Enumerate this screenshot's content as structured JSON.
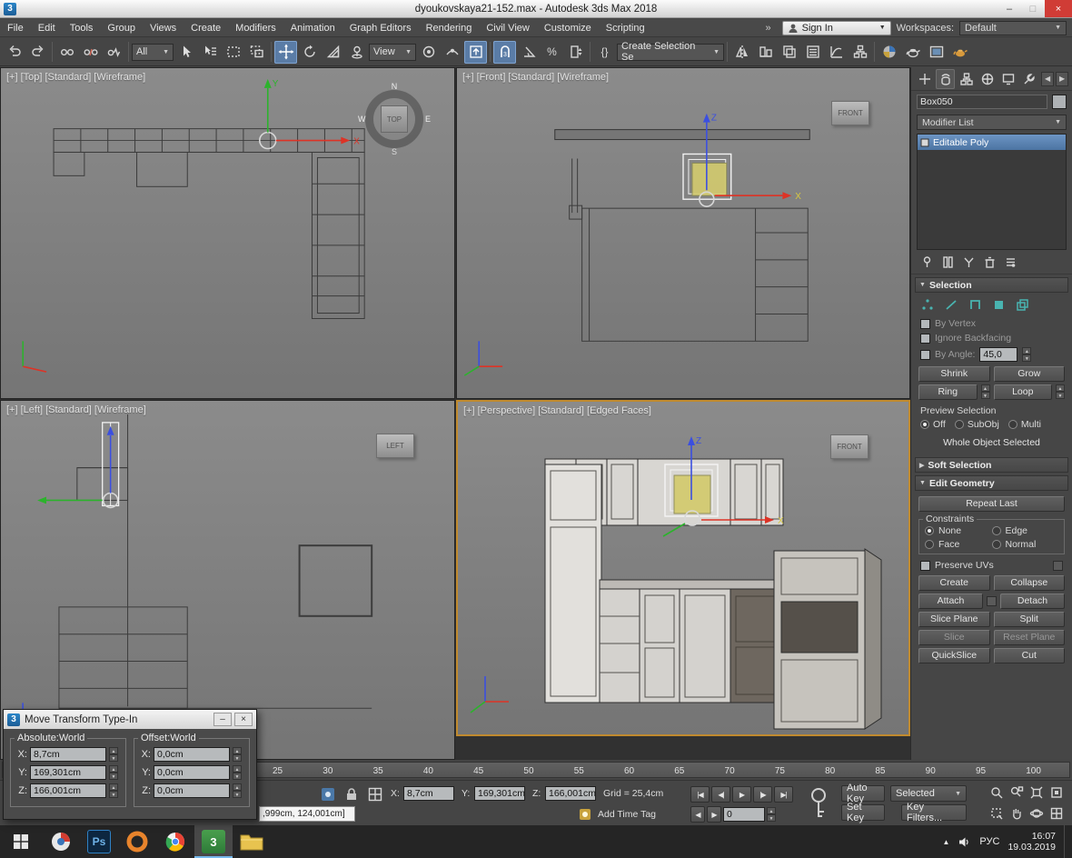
{
  "titlebar": {
    "title": "dyoukovskaya21-152.max - Autodesk 3ds Max 2018",
    "app_glyph": "3"
  },
  "menubar": {
    "items": [
      "File",
      "Edit",
      "Tools",
      "Group",
      "Views",
      "Create",
      "Modifiers",
      "Animation",
      "Graph Editors",
      "Rendering",
      "Civil View",
      "Customize",
      "Scripting"
    ],
    "sign_in": "Sign In",
    "workspaces_label": "Workspaces:",
    "workspace_value": "Default"
  },
  "toolbar": {
    "selection_filter": "All",
    "coord_system": "View",
    "selection_set_field": "Create Selection Se",
    "percent_glyph": "%",
    "braces_glyph": "{}"
  },
  "viewports": {
    "top_label": "[+] [Top] [Standard] [Wireframe]",
    "front_label": "[+] [Front] [Standard] [Wireframe]",
    "left_label": "[+] [Left] [Standard] [Wireframe]",
    "persp_label": "[+] [Perspective] [Standard] [Edged Faces]",
    "viewcube": {
      "n": "N",
      "w": "W",
      "s": "S",
      "e": "E",
      "top": "TOP",
      "front": "FRONT",
      "left": "LEFT"
    },
    "axis_x": "X",
    "axis_y": "Y",
    "axis_z": "Z"
  },
  "command_panel": {
    "object_name": "Box050",
    "modifier_list": "Modifier List",
    "stack_item": "Editable Poly",
    "selection": {
      "title": "Selection",
      "by_vertex": "By Vertex",
      "ignore_backfacing": "Ignore Backfacing",
      "by_angle": "By Angle:",
      "by_angle_value": "45,0",
      "shrink": "Shrink",
      "grow": "Grow",
      "ring": "Ring",
      "loop": "Loop",
      "preview": "Preview Selection",
      "off": "Off",
      "subobj": "SubObj",
      "multi": "Multi",
      "status": "Whole Object Selected"
    },
    "soft_selection_title": "Soft Selection",
    "edit_geometry": {
      "title": "Edit Geometry",
      "repeat_last": "Repeat Last",
      "constraints": "Constraints",
      "none": "None",
      "edge": "Edge",
      "face": "Face",
      "normal": "Normal",
      "preserve_uvs": "Preserve UVs",
      "create": "Create",
      "collapse": "Collapse",
      "attach": "Attach",
      "detach": "Detach",
      "slice_plane": "Slice Plane",
      "split": "Split",
      "slice": "Slice",
      "reset_plane": "Reset Plane",
      "quickslice": "QuickSlice",
      "cut": "Cut"
    }
  },
  "move_dialog": {
    "title": "Move Transform Type-In",
    "app_glyph": "3",
    "absolute_group": "Absolute:World",
    "offset_group": "Offset:World",
    "x_label": "X:",
    "y_label": "Y:",
    "z_label": "Z:",
    "absolute": {
      "x": "8,7cm",
      "y": "169,301cm",
      "z": "166,001cm"
    },
    "offset": {
      "x": "0,0cm",
      "y": "0,0cm",
      "z": "0,0cm"
    }
  },
  "timeline": {
    "ticks": [
      "25",
      "30",
      "35",
      "40",
      "45",
      "50",
      "55",
      "60",
      "65",
      "70",
      "75",
      "80",
      "85",
      "90",
      "95",
      "100"
    ]
  },
  "statusbar": {
    "prompt_text": ",999cm, 124,001cm]",
    "x_label": "X:",
    "x_value": "8,7cm",
    "y_label": "Y:",
    "y_value": "169,301cm",
    "z_label": "Z:",
    "z_value": "166,001cm",
    "grid_text": "Grid = 25,4cm",
    "add_time_tag": "Add Time Tag",
    "auto_key": "Auto Key",
    "set_key": "Set Key",
    "selected_dropdown": "Selected",
    "key_filters": "Key Filters...",
    "frame_value": "0"
  },
  "taskbar": {
    "photoshop_label": "Ps",
    "max_label": "3",
    "lang": "РУС",
    "time": "16:07",
    "date": "19.03.2019"
  },
  "glyphs": {
    "minimize": "–",
    "maximize": "□",
    "close": "×",
    "dropdown": "▼",
    "spin_up": "▲",
    "spin_down": "▼",
    "left": "◀",
    "right": "▶",
    "rollout_open": "▼",
    "rollout_closed": "▶",
    "go_start": "|◀",
    "prev_frame": "◀|",
    "play": "▶",
    "next_frame": "|▶",
    "go_end": "▶|",
    "tray_up": "▲",
    "overflow": "»"
  }
}
